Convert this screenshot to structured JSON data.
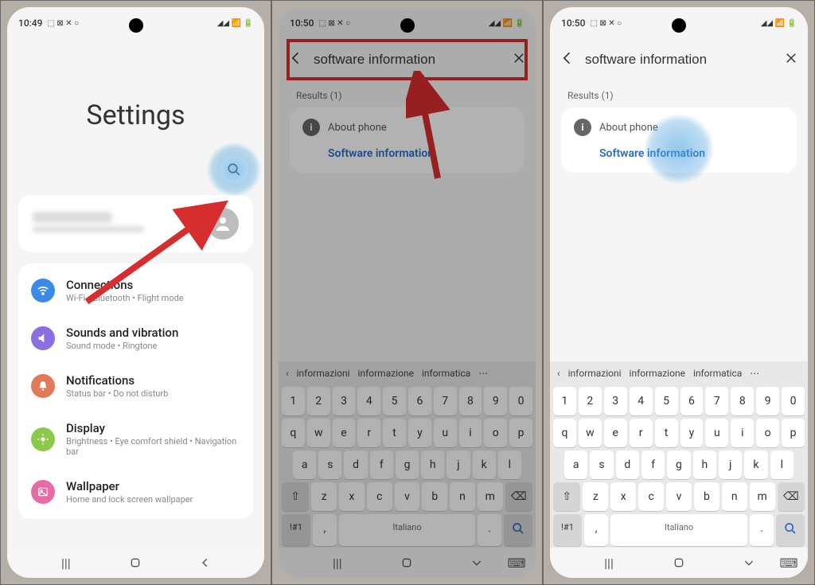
{
  "screen1": {
    "time": "10:49",
    "status_icons": "⬚ ⊠ ✕ ○",
    "signal_icons": "◢◢ 📶 🔋",
    "page_title": "Settings",
    "items": [
      {
        "title": "Connections",
        "sub": "Wi-Fi • Bluetooth • Flight mode",
        "color": "#3b8ae6",
        "icon": "wifi"
      },
      {
        "title": "Sounds and vibration",
        "sub": "Sound mode • Ringtone",
        "color": "#8a6fe0",
        "icon": "sound"
      },
      {
        "title": "Notifications",
        "sub": "Status bar • Do not disturb",
        "color": "#e07a5a",
        "icon": "bell"
      },
      {
        "title": "Display",
        "sub": "Brightness • Eye comfort shield • Navigation bar",
        "color": "#8bc94a",
        "icon": "sun"
      },
      {
        "title": "Wallpaper",
        "sub": "Home and lock screen wallpaper",
        "color": "#e86aa6",
        "icon": "image"
      }
    ]
  },
  "screen2": {
    "time": "10:50",
    "search_value": "software information",
    "results_label": "Results (1)",
    "result_parent": "About phone",
    "result_link": "Software information",
    "suggestions": [
      "informazioni",
      "informazione",
      "informatica"
    ],
    "kb_rows": {
      "num": [
        "1",
        "2",
        "3",
        "4",
        "5",
        "6",
        "7",
        "8",
        "9",
        "0"
      ],
      "r1": [
        "q",
        "w",
        "e",
        "r",
        "t",
        "y",
        "u",
        "i",
        "o",
        "p"
      ],
      "r2": [
        "a",
        "s",
        "d",
        "f",
        "g",
        "h",
        "j",
        "k",
        "l"
      ],
      "r3": [
        "z",
        "x",
        "c",
        "v",
        "b",
        "n",
        "m"
      ]
    },
    "space_label": "Italiano",
    "shift_label": "⇧",
    "bksp_label": "⌫",
    "symnum_label": "!#1",
    "comma": ",",
    "period": "."
  },
  "screen3": {
    "time": "10:50",
    "search_value": "software information",
    "results_label": "Results (1)",
    "result_parent": "About phone",
    "result_link": "Software information",
    "suggestions": [
      "informazioni",
      "informazione",
      "informatica"
    ],
    "space_label": "Italiano"
  }
}
